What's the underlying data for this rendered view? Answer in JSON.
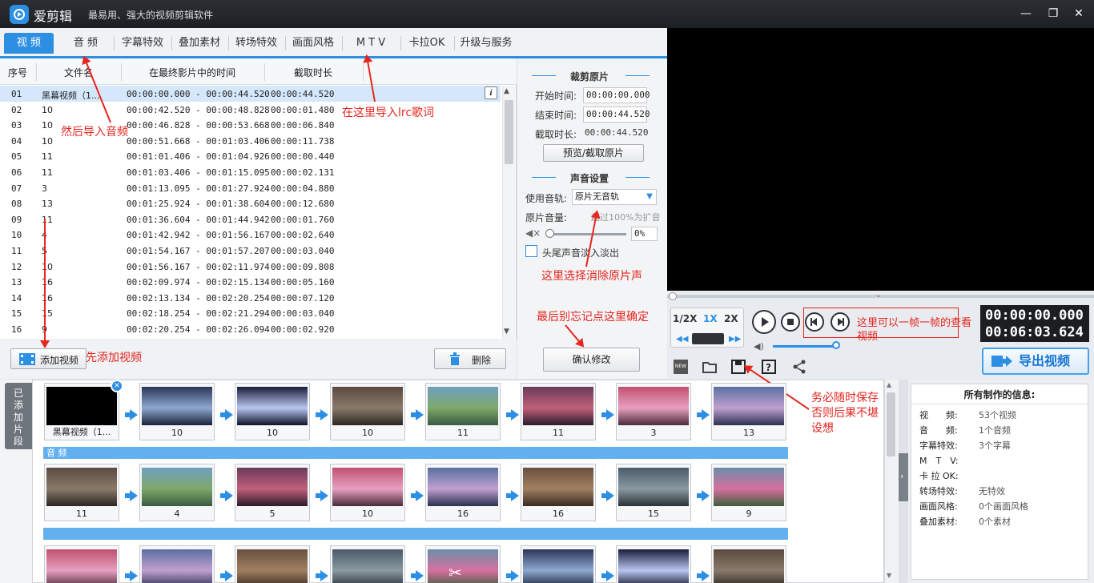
{
  "app": {
    "name": "爱剪辑",
    "slogan": "最易用、强大的视频剪辑软件",
    "window_buttons": [
      "—",
      "❐",
      "✕"
    ]
  },
  "tabs": [
    "视 频",
    "音 频",
    "字幕特效",
    "叠加素材",
    "转场特效",
    "画面风格",
    "M T V",
    "卡拉OK",
    "升级与服务"
  ],
  "list": {
    "headers": [
      "序号",
      "文件名",
      "在最终影片中的时间",
      "截取时长"
    ],
    "rows": [
      {
        "no": "01",
        "name": "黑幕视频（1...",
        "time": "00:00:00.000 - 00:00:44.520",
        "dur": "00:00:44.520"
      },
      {
        "no": "02",
        "name": "10",
        "time": "00:00:42.520 - 00:00:48.828",
        "dur": "00:00:01.480"
      },
      {
        "no": "03",
        "name": "10",
        "time": "00:00:46.828 - 00:00:53.668",
        "dur": "00:00:06.840"
      },
      {
        "no": "04",
        "name": "10",
        "time": "00:00:51.668 - 00:01:03.406",
        "dur": "00:00:11.738"
      },
      {
        "no": "05",
        "name": "11",
        "time": "00:01:01.406 - 00:01:04.926",
        "dur": "00:00:00.440"
      },
      {
        "no": "06",
        "name": "11",
        "time": "00:01:03.406 - 00:01:15.095",
        "dur": "00:00:02.131"
      },
      {
        "no": "07",
        "name": "3",
        "time": "00:01:13.095 - 00:01:27.924",
        "dur": "00:00:04.880"
      },
      {
        "no": "08",
        "name": "13",
        "time": "00:01:25.924 - 00:01:38.604",
        "dur": "00:00:12.680"
      },
      {
        "no": "09",
        "name": "11",
        "time": "00:01:36.604 - 00:01:44.942",
        "dur": "00:00:01.760"
      },
      {
        "no": "10",
        "name": "4",
        "time": "00:01:42.942 - 00:01:56.167",
        "dur": "00:00:02.640"
      },
      {
        "no": "11",
        "name": "5",
        "time": "00:01:54.167 - 00:01:57.207",
        "dur": "00:00:03.040"
      },
      {
        "no": "12",
        "name": "10",
        "time": "00:01:56.167 - 00:02:11.974",
        "dur": "00:00:09.808"
      },
      {
        "no": "13",
        "name": "16",
        "time": "00:02:09.974 - 00:02:15.134",
        "dur": "00:00:05.160"
      },
      {
        "no": "14",
        "name": "16",
        "time": "00:02:13.134 - 00:02:20.254",
        "dur": "00:00:07.120"
      },
      {
        "no": "15",
        "name": "15",
        "time": "00:02:18.254 - 00:02:21.294",
        "dur": "00:00:03.040"
      },
      {
        "no": "16",
        "name": "9",
        "time": "00:02:20.254 - 00:02:26.094",
        "dur": "00:00:02.920"
      }
    ],
    "add_label": "添加视频",
    "delete_label": "删除"
  },
  "cut": {
    "title": "裁剪原片",
    "start_label": "开始时间:",
    "start_value": "00:00:00.000",
    "end_label": "结束时间:",
    "end_value": "00:00:44.520",
    "dur_label": "截取时长:",
    "dur_value": "00:00:44.520",
    "preview_btn": "预览/截取原片",
    "sound_title": "声音设置",
    "track_label": "使用音轨:",
    "track_value": "原片无音轨",
    "volume_label": "原片音量:",
    "volume_hint": "超过100%为扩音",
    "volume_value": "0%",
    "fade_label": "头尾声音淡入淡出",
    "confirm_btn": "确认修改"
  },
  "player": {
    "speeds": [
      "1/2X",
      "1X",
      "2X"
    ],
    "time_current": "00:00:00.000",
    "time_total": "00:06:03.624",
    "export_label": "导出视频"
  },
  "timeline": {
    "side_tab": "已添加片段",
    "audio_label": "音 频",
    "row1": [
      "黑幕视频（1...",
      "10",
      "10",
      "10",
      "11",
      "11",
      "3",
      "13"
    ],
    "row2": [
      "11",
      "4",
      "5",
      "10",
      "16",
      "16",
      "15",
      "9"
    ]
  },
  "info": {
    "title": "所有制作的信息:",
    "items": [
      {
        "k": "视　　频:",
        "v": "53个视频"
      },
      {
        "k": "音　　频:",
        "v": "1个音频"
      },
      {
        "k": "字幕特效:",
        "v": "3个字幕"
      },
      {
        "k": "M　T　V:",
        "v": ""
      },
      {
        "k": "卡 拉 OK:",
        "v": ""
      },
      {
        "k": "转场特效:",
        "v": "无特效"
      },
      {
        "k": "画面风格:",
        "v": "0个画面风格"
      },
      {
        "k": "叠加素材:",
        "v": "0个素材"
      }
    ]
  },
  "annotations": {
    "import_audio": "然后导入音频",
    "import_lrc": "在这里导入lrc歌词",
    "remove_sound": "这里选择消除原片声",
    "confirm": "最后别忘记点这里确定",
    "frame_step": "这里可以一帧一帧的查看视频",
    "add_video_first": "先添加视频",
    "save_often_1": "务必随时保存",
    "save_often_2": "否则后果不堪",
    "save_often_3": "设想"
  },
  "colors": {
    "accent": "#2d8fe3",
    "annotation": "#e6261f"
  }
}
